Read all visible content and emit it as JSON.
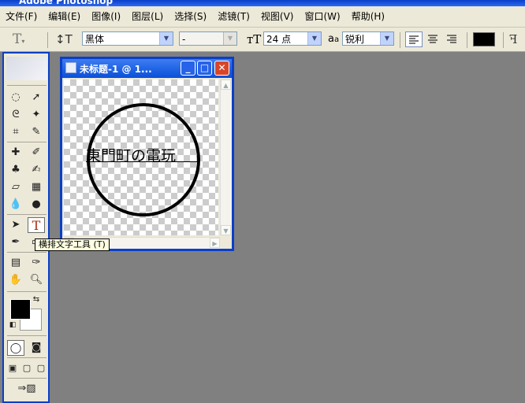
{
  "app": {
    "title": "Adobe Photoshop"
  },
  "menu": [
    "文件(F)",
    "编辑(E)",
    "图像(I)",
    "图层(L)",
    "选择(S)",
    "滤镜(T)",
    "视图(V)",
    "窗口(W)",
    "帮助(H)"
  ],
  "options": {
    "font_family": "黑体",
    "font_style": "-",
    "font_size": "24 点",
    "aa_prefix": "a",
    "aa_mode": "锐利",
    "color_swatch": "#000000"
  },
  "document": {
    "title": "未标题-1 @ 1...",
    "text": "東門町の電玩"
  },
  "tooltip": "横排文字工具 (T)",
  "colors": {
    "foreground": "#000000",
    "background": "#ffffff",
    "accent": "#0a3fc8"
  },
  "icons": [
    "marquee-icon",
    "move-icon",
    "lasso-icon",
    "magic-wand-icon",
    "crop-icon",
    "slice-icon",
    "healing-brush-icon",
    "brush-icon",
    "clone-stamp-icon",
    "history-brush-icon",
    "eraser-icon",
    "gradient-icon",
    "blur-icon",
    "dodge-icon",
    "path-select-icon",
    "type-tool-icon",
    "pen-icon",
    "shape-icon",
    "notes-icon",
    "eyedropper-icon",
    "hand-icon",
    "zoom-icon"
  ]
}
